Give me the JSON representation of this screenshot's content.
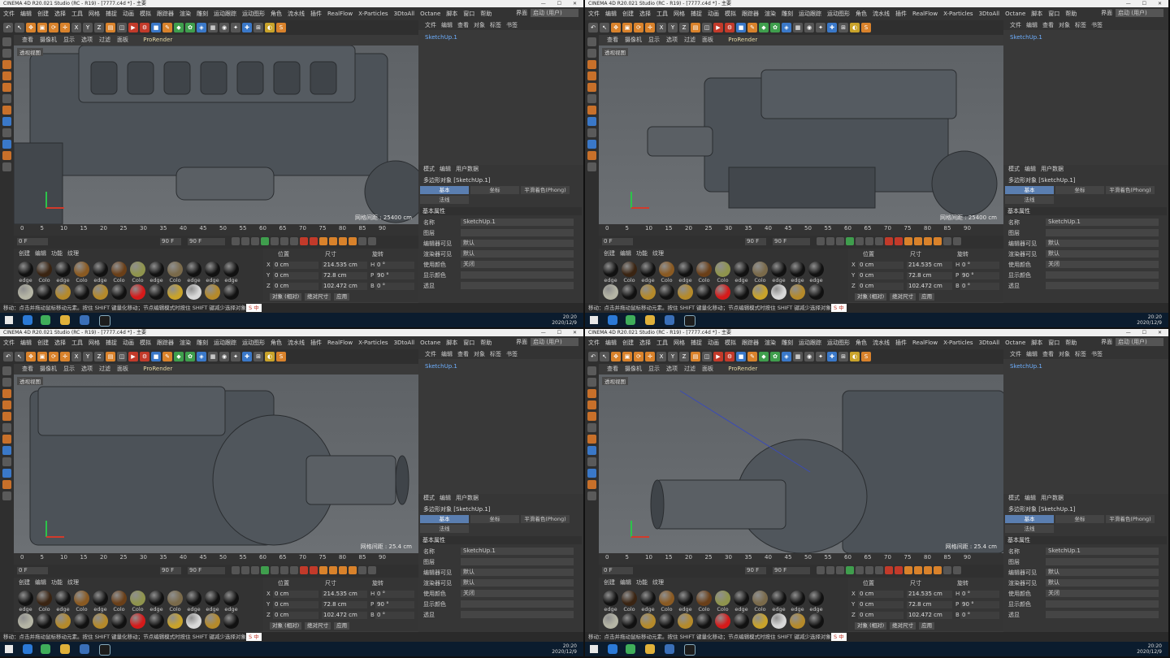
{
  "window_title": "CINEMA 4D R20.021 Studio (RC - R19) - [7777.c4d *] - 主要",
  "menu": [
    "文件",
    "编辑",
    "创建",
    "选择",
    "工具",
    "网格",
    "捕捉",
    "动画",
    "模拟",
    "跟踪器",
    "渲染",
    "雕刻",
    "运动跟踪",
    "运动图形",
    "角色",
    "流水线",
    "插件",
    "RealFlow",
    "X-Particles",
    "3DtoAll",
    "Octane",
    "脚本",
    "窗口",
    "帮助"
  ],
  "layout": {
    "label": "界面",
    "value": "启动 (用户)"
  },
  "viewport_menu": [
    "查看",
    "摄像机",
    "显示",
    "选项",
    "过滤",
    "面板"
  ],
  "prorender": "ProRender",
  "viewport_label": "透视视图",
  "timeline_ticks": [
    "0",
    "5",
    "10",
    "15",
    "20",
    "25",
    "30",
    "35",
    "40",
    "45",
    "50",
    "55",
    "60",
    "65",
    "70",
    "75",
    "80",
    "85",
    "90"
  ],
  "frames": {
    "current": "0 F",
    "start": "0 F",
    "end": "90 F",
    "max": "90 F",
    "range_end": "0 F"
  },
  "material_tabs": [
    "创建",
    "编辑",
    "功能",
    "纹理"
  ],
  "material_rows": [
    [
      {
        "label": "edge",
        "color": "#111111"
      },
      {
        "label": "Colo",
        "color": "#3a2412"
      },
      {
        "label": "edge",
        "color": "#111111"
      },
      {
        "label": "Colo",
        "color": "#8a5a22"
      },
      {
        "label": "edge",
        "color": "#111111"
      },
      {
        "label": "Colo",
        "color": "#6a3f18"
      },
      {
        "label": "Colo",
        "color": "#8f944d"
      },
      {
        "label": "edge",
        "color": "#111111"
      },
      {
        "label": "Colo",
        "color": "#7a6a4a"
      },
      {
        "label": "edge",
        "color": "#111111"
      },
      {
        "label": "edge",
        "color": "#111111"
      },
      {
        "label": "edge",
        "color": "#111111"
      }
    ],
    [
      {
        "label": "",
        "color": "#b5b5a5"
      },
      {
        "label": "",
        "color": "#111111"
      },
      {
        "label": "",
        "color": "#b58a2a"
      },
      {
        "label": "",
        "color": "#111111"
      },
      {
        "label": "",
        "color": "#b58a2a"
      },
      {
        "label": "",
        "color": "#111111"
      },
      {
        "label": "",
        "color": "#d61a1a"
      },
      {
        "label": "",
        "color": "#111111"
      },
      {
        "label": "",
        "color": "#c9a32a"
      },
      {
        "label": "",
        "color": "#d8d8d8"
      },
      {
        "label": "",
        "color": "#b58a2a"
      },
      {
        "label": "",
        "color": "#111111"
      }
    ]
  ],
  "coord": {
    "headers": [
      "位置",
      "尺寸",
      "旋转"
    ],
    "rows": [
      {
        "axis": "X",
        "pos": "0 cm",
        "size": "214.535 cm",
        "rot_axis": "H",
        "rot": "0 °"
      },
      {
        "axis": "Y",
        "pos": "0 cm",
        "size": "72.8 cm",
        "rot_axis": "P",
        "rot": "90 °"
      },
      {
        "axis": "Z",
        "pos": "0 cm",
        "size": "102.472 cm",
        "rot_axis": "B",
        "rot": "0 °"
      }
    ],
    "mode": "对象 (相对)",
    "size_mode": "绝对尺寸",
    "apply": "应用"
  },
  "objmgr": {
    "tabs": [
      "文件",
      "编辑",
      "查看",
      "对象",
      "标签",
      "书签"
    ],
    "item": "SketchUp.1"
  },
  "attrmgr": {
    "tabs": [
      "模式",
      "编辑",
      "用户数据"
    ],
    "object_title": "多边形对象 [SketchUp.1]",
    "subtabs": [
      "基本",
      "坐标",
      "平滑着色(Phong)"
    ],
    "phong": "法线",
    "section": "基本属性",
    "props": [
      {
        "k": "名称",
        "v": "SketchUp.1"
      },
      {
        "k": "图层",
        "v": ""
      },
      {
        "k": "编辑器可见",
        "v": "默认"
      },
      {
        "k": "渲染器可见",
        "v": "默认"
      },
      {
        "k": "使用颜色",
        "v": "关闭"
      },
      {
        "k": "显示颜色",
        "v": ""
      },
      {
        "k": "透显",
        "v": ""
      }
    ]
  },
  "status": "移动：点击并拖动鼠标移动元素。按住 SHIFT 键量化移动；节点编辑模式时按住 SHIFT 键减少选择对象。",
  "quads": [
    {
      "grid": "网格间距 : 25400 cm"
    },
    {
      "grid": "网格间距 : 25400 cm"
    },
    {
      "grid": "网格间距 : 25.4 cm"
    },
    {
      "grid": "网格间距 : 25.4 cm"
    }
  ],
  "clock": {
    "time": "20:20",
    "date": "2020/12/9"
  }
}
